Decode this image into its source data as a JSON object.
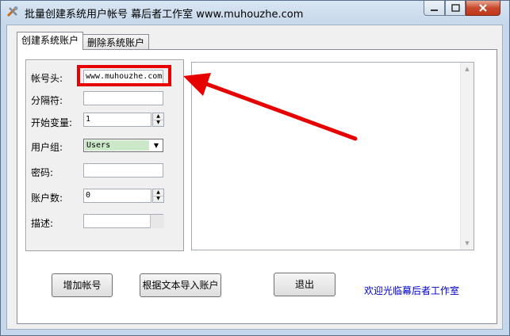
{
  "window": {
    "title": "批量创建系统用户帐号  幕后者工作室  www.muhouzhe.com",
    "controls": {
      "minimize": "minimize",
      "maximize": "maximize",
      "close": "close"
    }
  },
  "tabs": [
    {
      "label": "创建系统账户",
      "active": true
    },
    {
      "label": "删除系统账户",
      "active": false
    }
  ],
  "form": {
    "account_prefix": {
      "label": "帐号头:",
      "value": "www.muhouzhe.com"
    },
    "separator": {
      "label": "分隔符:",
      "value": ""
    },
    "start_var": {
      "label": "开始变量:",
      "value": "1"
    },
    "user_group": {
      "label": "用户组:",
      "value": "Users"
    },
    "password": {
      "label": "密码:",
      "value": ""
    },
    "account_count": {
      "label": "账户数:",
      "value": "0"
    },
    "description": {
      "label": "描述:",
      "value": ""
    }
  },
  "buttons": {
    "add_account": "增加帐号",
    "import_from_text": "根据文本导入账户",
    "exit": "退出"
  },
  "welcome_text": "欢迎光临幕后者工作室",
  "annotation": {
    "color": "#e60000"
  }
}
